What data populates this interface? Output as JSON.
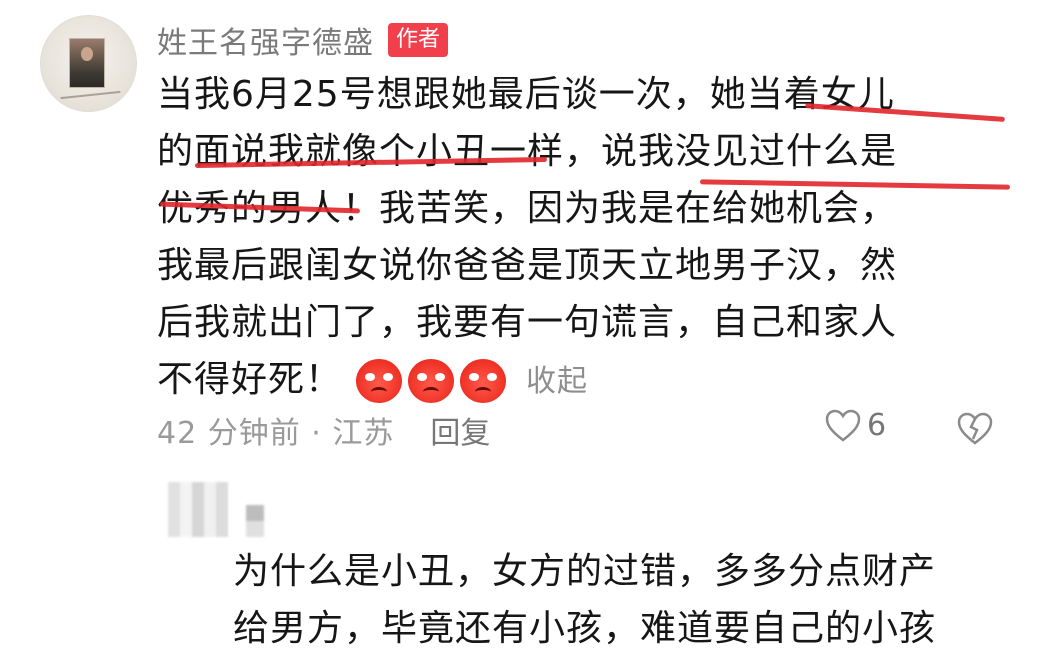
{
  "comment": {
    "author_name": "姓王名强字德盛",
    "author_badge": "作者",
    "lines": [
      "当我6月25号想跟她最后谈一次，她当着女儿",
      "的面说我就像个小丑一样，说我没见过什么是",
      "优秀的男人！我苦笑，因为我是在给她机会，",
      "我最后跟闺女说你爸爸是顶天立地男子汉，然",
      "后我就出门了，我要有一句谎言，自己和家人",
      "不得好死！"
    ],
    "emojis": [
      "angry-emoji",
      "angry-emoji",
      "angry-emoji"
    ],
    "collapse_label": "收起",
    "time_location": "42 分钟前 · 江苏",
    "reply_label": "回复",
    "like_count": "6",
    "colors": {
      "badge": "#f1404b",
      "underline": "#e0262b"
    }
  },
  "reply": {
    "lines": [
      "为什么是小丑，女方的过错，多多分点财产",
      "给男方，毕竟还有小孩，难道要自己的小孩"
    ]
  }
}
